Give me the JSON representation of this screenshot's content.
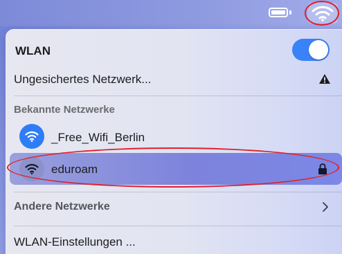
{
  "menubar": {
    "battery_icon": "battery-icon",
    "wifi_icon": "wifi-icon"
  },
  "wlan": {
    "title": "WLAN",
    "toggle_on": true
  },
  "unsecured": {
    "label": "Ungesichertes Netzwerk...",
    "icon": "warning-icon"
  },
  "known": {
    "header": "Bekannte Netzwerke",
    "networks": [
      {
        "name": "_Free_Wifi_Berlin",
        "icon": "wifi-icon",
        "selected": false
      },
      {
        "name": "eduroam",
        "icon": "wifi-icon",
        "selected": true,
        "locked": true
      }
    ]
  },
  "other": {
    "label": "Andere Netzwerke",
    "icon": "chevron-right-icon"
  },
  "settings": {
    "label": "WLAN-Einstellungen ..."
  },
  "colors": {
    "accent": "#3a82f7",
    "annotation": "#e0202a"
  }
}
